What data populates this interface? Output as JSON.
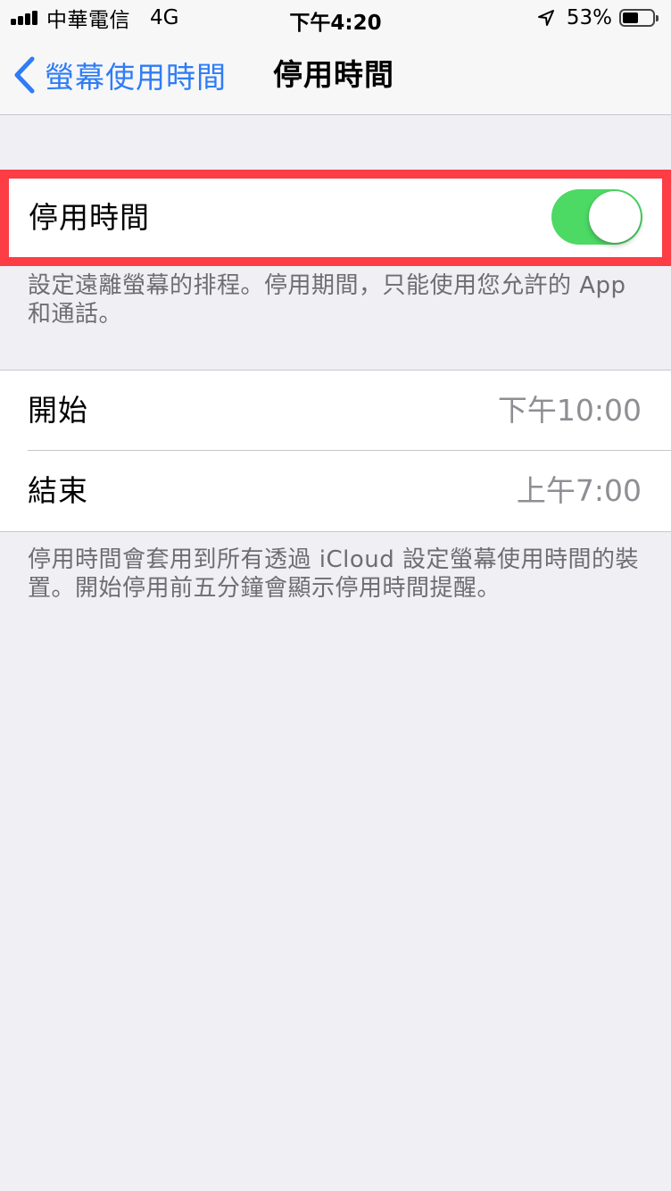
{
  "status_bar": {
    "carrier": "中華電信",
    "network": "4G",
    "time": "下午4:20",
    "battery_percent": "53%",
    "battery_level": 0.53,
    "signal_bars": 4
  },
  "nav": {
    "back_label": "螢幕使用時間",
    "title": "停用時間"
  },
  "downtime": {
    "label": "停用時間",
    "enabled": true,
    "footer": "設定遠離螢幕的排程。停用期間，只能使用您允許的 App 和通話。"
  },
  "schedule": {
    "start_label": "開始",
    "start_value": "下午10:00",
    "end_label": "結束",
    "end_value": "上午7:00",
    "footer": "停用時間會套用到所有透過 iCloud 設定螢幕使用時間的裝置。開始停用前五分鐘會顯示停用時間提醒。"
  },
  "colors": {
    "accent": "#2f7cf6",
    "toggle_on": "#4cd964",
    "highlight_border": "#fc3d45",
    "background": "#efeff4",
    "secondary_text": "#8e8e93"
  },
  "icons": {
    "signal": "signal-bars-icon",
    "location": "location-arrow-icon",
    "battery": "battery-icon",
    "back": "chevron-left-icon"
  }
}
